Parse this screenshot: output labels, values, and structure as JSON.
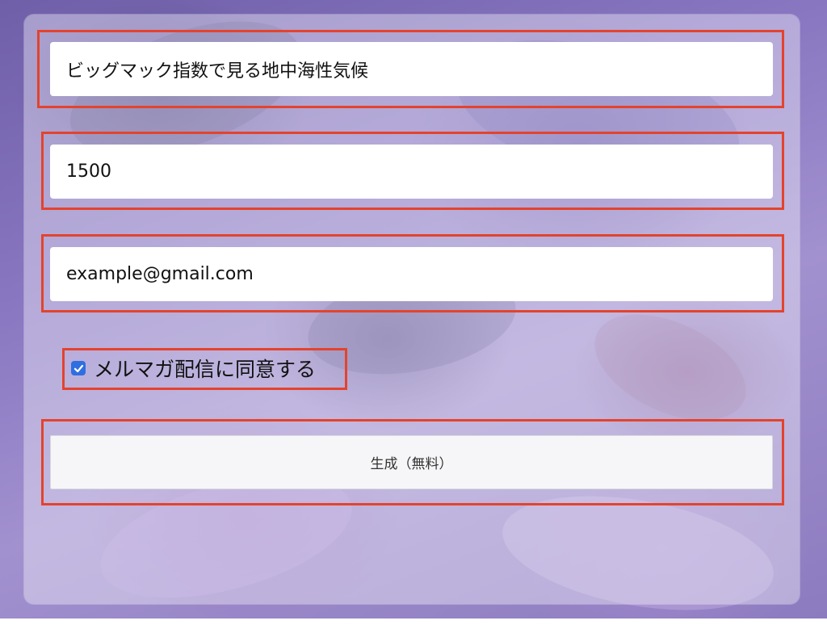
{
  "form": {
    "title_value": "ビッグマック指数で見る地中海性気候",
    "number_value": "1500",
    "email_value": "example@gmail.com",
    "newsletter": {
      "checked": true,
      "label": "メルマガ配信に同意する"
    },
    "submit_label": "生成（無料）"
  },
  "colors": {
    "highlight": "#e4432d",
    "checkbox": "#2f6fe0"
  },
  "icons": {
    "check": "checkmark-icon"
  }
}
